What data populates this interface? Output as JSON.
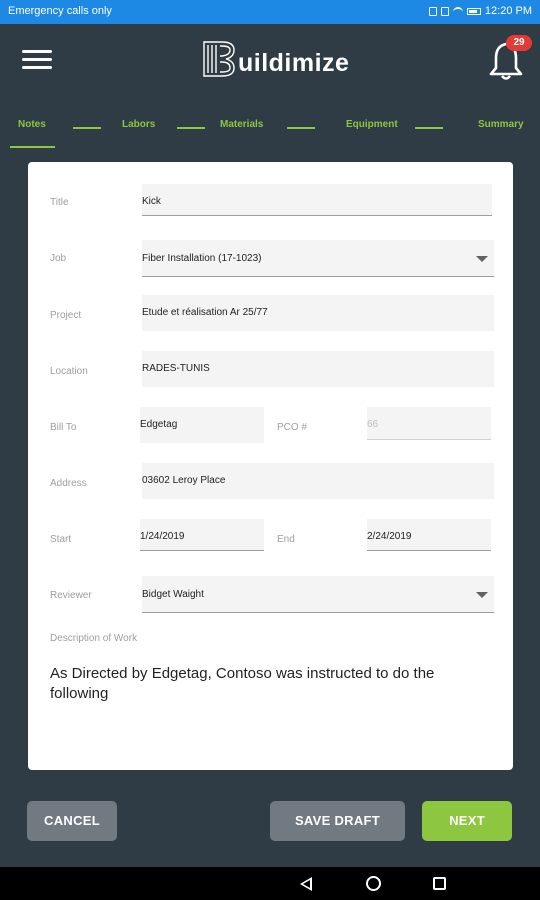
{
  "status_bar": {
    "left_text": "Emergency calls only",
    "time": "12:20 PM"
  },
  "header": {
    "brand": "uildimize",
    "notification_count": "29"
  },
  "steps": [
    "Notes",
    "Labors",
    "Materials",
    "Equipment",
    "Summary"
  ],
  "form": {
    "title_label": "Title",
    "title_value": "Kick",
    "job_label": "Job",
    "job_value": "Fiber Installation (17-1023)",
    "project_label": "Project",
    "project_value": "Etude et réalisation Ar 25/77",
    "location_label": "Location",
    "location_value": "RADES-TUNIS",
    "bill_to_label": "Bill To",
    "bill_to_value": "Edgetag",
    "pco_label": "PCO #",
    "pco_placeholder": "66",
    "address_label": "Address",
    "address_value": "03602 Leroy Place",
    "start_label": "Start",
    "start_value": "1/24/2019",
    "end_label": "End",
    "end_value": "2/24/2019",
    "reviewer_label": "Reviewer",
    "reviewer_value": "Bidget Waight",
    "description_label": "Description of Work",
    "description_value": "As Directed by Edgetag, Contoso was instructed to do the following"
  },
  "actions": {
    "cancel": "CANCEL",
    "save_draft": "SAVE DRAFT",
    "next": "NEXT"
  },
  "colors": {
    "accent": "#8dc63f",
    "background": "#2f3c45",
    "status_bar": "#1e88e5",
    "badge": "#e53935"
  }
}
